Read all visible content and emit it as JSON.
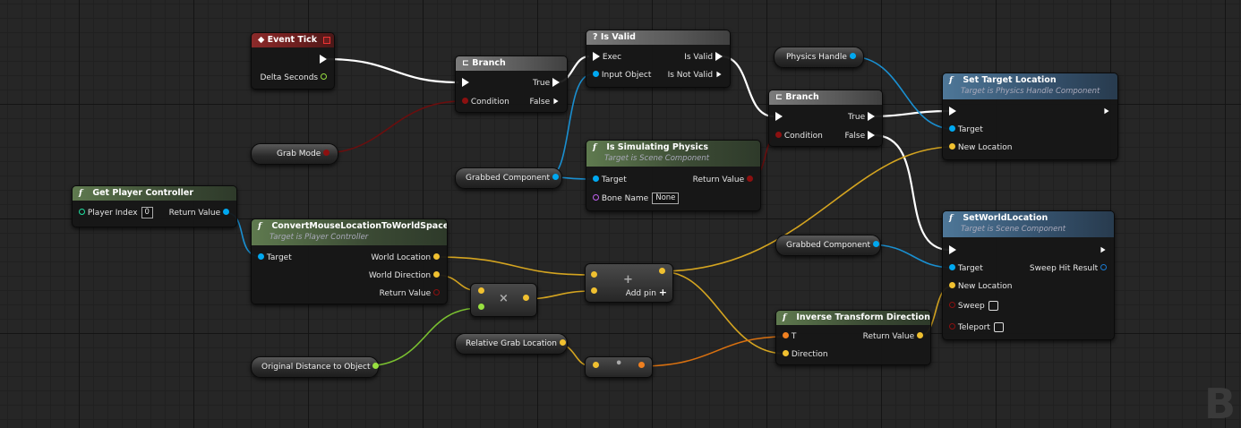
{
  "colors": {
    "exec": "#ffffff",
    "bool": "#8c1010",
    "object": "#00a8f0",
    "vector": "#f0c030",
    "float": "#98e040",
    "int": "#20e0a0",
    "name": "#c060f0",
    "transform": "#f08020"
  },
  "nodes": {
    "event_tick": {
      "title": "Event Tick",
      "delta_seconds": "Delta Seconds"
    },
    "branch1": {
      "title": "Branch",
      "condition": "Condition",
      "true": "True",
      "false": "False"
    },
    "is_valid": {
      "title": "Is Valid",
      "exec": "Exec",
      "input_object": "Input Object",
      "is_valid": "Is Valid",
      "is_not_valid": "Is Not Valid"
    },
    "branch2": {
      "title": "Branch",
      "condition": "Condition",
      "true": "True",
      "false": "False"
    },
    "set_target": {
      "title": "Set Target Location",
      "subtitle": "Target is Physics Handle Component",
      "target": "Target",
      "new_location": "New Location"
    },
    "is_sim": {
      "title": "Is Simulating Physics",
      "subtitle": "Target is Scene Component",
      "target": "Target",
      "bone_name": "Bone Name",
      "bone_value": "None",
      "return_value": "Return Value"
    },
    "get_pc": {
      "title": "Get Player Controller",
      "player_index": "Player Index",
      "player_index_value": "0",
      "return_value": "Return Value"
    },
    "convert": {
      "title": "ConvertMouseLocationToWorldSpace",
      "subtitle": "Target is Player Controller",
      "target": "Target",
      "world_location": "World Location",
      "world_direction": "World Direction",
      "return_value": "Return Value"
    },
    "set_world": {
      "title": "SetWorldLocation",
      "subtitle": "Target is Scene Component",
      "target": "Target",
      "new_location": "New Location",
      "sweep": "Sweep",
      "teleport": "Teleport",
      "sweep_hit": "Sweep Hit Result"
    },
    "inv_dir": {
      "title": "Inverse Transform Direction",
      "t": "T",
      "direction": "Direction",
      "return_value": "Return Value"
    },
    "add": {
      "add_pin": "Add pin"
    }
  },
  "variables": {
    "grab_mode": "Grab Mode",
    "grabbed_component_1": "Grabbed Component",
    "physics_handle": "Physics Handle",
    "grabbed_component_2": "Grabbed Component",
    "relative_grab_location": "Relative Grab Location",
    "original_distance": "Original Distance to Object"
  },
  "operators": {
    "multiply": "×",
    "add": "+",
    "dot": "•"
  },
  "watermark": "B"
}
